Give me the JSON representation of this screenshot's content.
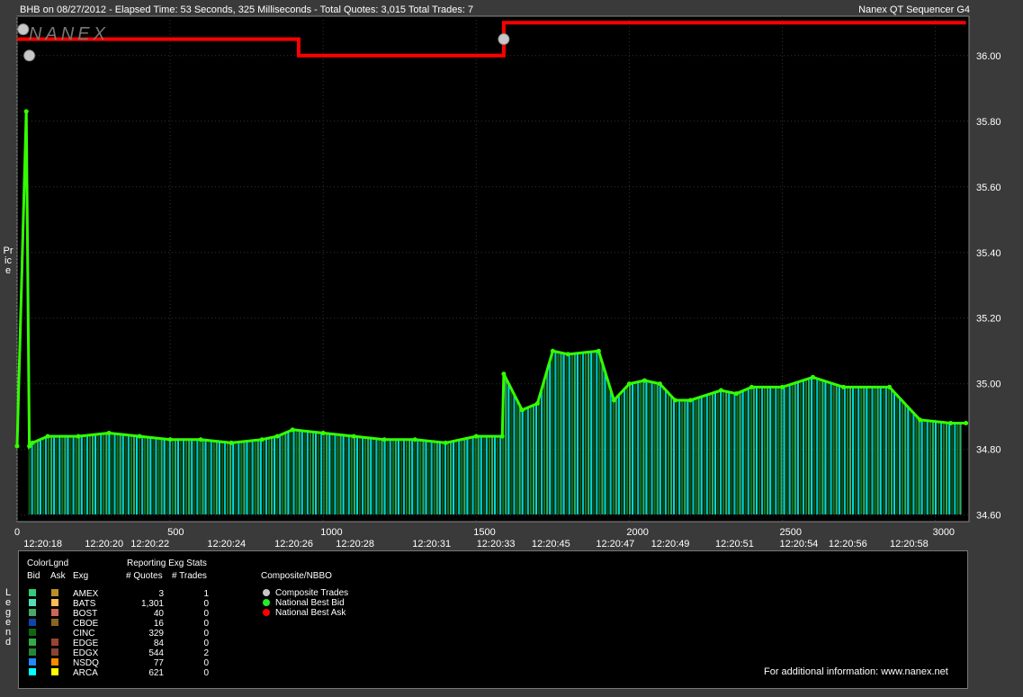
{
  "header": {
    "left": "BHB on 08/27/2012  -  Elapsed Time: 53 Seconds, 325 Milliseconds  -  Total Quotes: 3,015  Total Trades: 7",
    "right": "Nanex QT Sequencer G4"
  },
  "watermark": "NANEX",
  "axis": {
    "y_side_label": "Price",
    "legend_side_label": "Legend"
  },
  "chart_data": {
    "type": "line",
    "title": "BHB on 08/27/2012",
    "ylabel": "Price",
    "xlim": [
      0,
      3110
    ],
    "ylim": [
      34.58,
      36.12
    ],
    "grid": true,
    "y_ticks": [
      "36.00",
      "35.80",
      "35.60",
      "35.40",
      "35.20",
      "35.00",
      "34.80",
      "34.60"
    ],
    "x_ticks": [
      "0",
      "500",
      "1000",
      "1500",
      "2000",
      "2500",
      "3000"
    ],
    "x_ticks_values": [
      0,
      500,
      1000,
      1500,
      2000,
      2500,
      3000
    ],
    "y_ticks_values": [
      36.0,
      35.8,
      35.6,
      35.4,
      35.2,
      35.0,
      34.8,
      34.6
    ],
    "time_labels": [
      {
        "label": "12:20:18",
        "x": 80
      },
      {
        "label": "12:20:20",
        "x": 280
      },
      {
        "label": "12:20:22",
        "x": 430
      },
      {
        "label": "12:20:24",
        "x": 680
      },
      {
        "label": "12:20:26",
        "x": 900
      },
      {
        "label": "12:20:28",
        "x": 1100
      },
      {
        "label": "12:20:31",
        "x": 1350
      },
      {
        "label": "12:20:33",
        "x": 1560
      },
      {
        "label": "12:20:45",
        "x": 1740
      },
      {
        "label": "12:20:47",
        "x": 1950
      },
      {
        "label": "12:20:49",
        "x": 2130
      },
      {
        "label": "12:20:51",
        "x": 2340
      },
      {
        "label": "12:20:54",
        "x": 2550
      },
      {
        "label": "12:20:56",
        "x": 2710
      },
      {
        "label": "12:20:58",
        "x": 2910
      }
    ],
    "series": [
      {
        "name": "National Best Ask",
        "color": "#ff0000",
        "x": [
          0,
          40,
          40,
          920,
          920,
          1590,
          1590,
          3100
        ],
        "y": [
          36.05,
          36.05,
          36.05,
          36.05,
          36.0,
          36.0,
          36.1,
          36.1
        ]
      },
      {
        "name": "National Best Bid",
        "color": "#33ff00",
        "x": [
          0,
          30,
          40,
          50,
          100,
          200,
          300,
          400,
          500,
          600,
          700,
          800,
          850,
          900,
          1000,
          1100,
          1200,
          1300,
          1400,
          1500,
          1585,
          1590,
          1650,
          1700,
          1750,
          1800,
          1900,
          1950,
          2000,
          2050,
          2100,
          2150,
          2200,
          2300,
          2350,
          2400,
          2500,
          2600,
          2700,
          2850,
          2950,
          3050,
          3100
        ],
        "y": [
          34.81,
          35.83,
          34.81,
          34.82,
          34.84,
          34.84,
          34.85,
          34.84,
          34.83,
          34.83,
          34.82,
          34.83,
          34.84,
          34.86,
          34.85,
          34.84,
          34.83,
          34.83,
          34.82,
          34.84,
          34.84,
          35.03,
          34.92,
          34.94,
          35.1,
          35.09,
          35.1,
          34.95,
          35.0,
          35.01,
          35.0,
          34.95,
          34.95,
          34.98,
          34.97,
          34.99,
          34.99,
          35.02,
          34.99,
          34.99,
          34.89,
          34.88,
          34.88
        ]
      },
      {
        "name": "Composite Trades",
        "color": "#c8c8c8",
        "x": [
          20,
          40,
          1590
        ],
        "y": [
          36.08,
          36.0,
          36.05
        ]
      }
    ]
  },
  "legend": {
    "title": "ColorLgnd",
    "col_bid": "Bid",
    "col_ask": "Ask",
    "col_exg": "Exg",
    "stats_title": "Reporting Exg Stats",
    "col_quotes": "# Quotes",
    "col_trades": "# Trades",
    "composite_title": "Composite/NBBO",
    "exchanges": [
      {
        "exg": "AMEX",
        "quotes": "3",
        "trades": "1",
        "bid_color": "#33cc77",
        "ask_color": "#b8902a"
      },
      {
        "exg": "BATS",
        "quotes": "1,301",
        "trades": "0",
        "bid_color": "#55ddbb",
        "ask_color": "#ffbb55"
      },
      {
        "exg": "BOST",
        "quotes": "40",
        "trades": "0",
        "bid_color": "#44aa66",
        "ask_color": "#cc6655"
      },
      {
        "exg": "CBOE",
        "quotes": "16",
        "trades": "0",
        "bid_color": "#1144aa",
        "ask_color": "#886622"
      },
      {
        "exg": "CINC",
        "quotes": "329",
        "trades": "0",
        "bid_color": "#116611",
        "ask_color": "#000000"
      },
      {
        "exg": "EDGE",
        "quotes": "84",
        "trades": "0",
        "bid_color": "#33aa44",
        "ask_color": "#994433"
      },
      {
        "exg": "EDGX",
        "quotes": "544",
        "trades": "2",
        "bid_color": "#228833",
        "ask_color": "#884433"
      },
      {
        "exg": "NSDQ",
        "quotes": "77",
        "trades": "0",
        "bid_color": "#2288ff",
        "ask_color": "#ff8800"
      },
      {
        "exg": "ARCA",
        "quotes": "621",
        "trades": "0",
        "bid_color": "#00ffff",
        "ask_color": "#ffff00"
      }
    ],
    "composite": [
      {
        "label": "Composite Trades",
        "color": "#c8c8c8"
      },
      {
        "label": "National Best Bid",
        "color": "#22ee22"
      },
      {
        "label": "National Best Ask",
        "color": "#ff0000"
      }
    ],
    "footer": "For additional information: www.nanex.net"
  }
}
